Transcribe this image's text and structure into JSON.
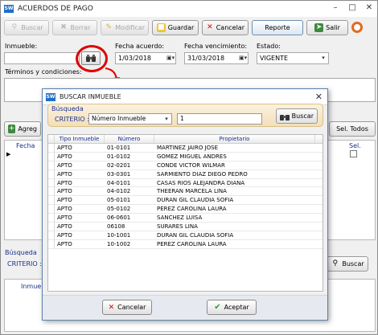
{
  "window": {
    "title": "ACUERDOS DE PAGO"
  },
  "toolbar": {
    "buttons": [
      {
        "label": "Buscar",
        "enabled": false
      },
      {
        "label": "Borrar",
        "enabled": false
      },
      {
        "label": "Modificar",
        "enabled": false
      },
      {
        "label": "Guardar",
        "enabled": true
      },
      {
        "label": "Cancelar",
        "enabled": true
      },
      {
        "label": "Reporte",
        "enabled": true
      },
      {
        "label": "Salir",
        "enabled": true
      }
    ]
  },
  "form": {
    "inmueble_label": "Inmueble:",
    "fecha_acuerdo_label": "Fecha acuerdo:",
    "fecha_acuerdo_value": "1/03/2018",
    "fecha_venc_label": "Fecha vencimiento:",
    "fecha_venc_value": "31/03/2018",
    "estado_label": "Estado:",
    "estado_value": "VIGENTE",
    "terminos_label": "Términos y condiciones:"
  },
  "background": {
    "agregar_label": "Agreg",
    "sel_todos_label": "Sel. Todos",
    "fecha_col": "Fecha",
    "sel_col": "Sel.",
    "busqueda_label": "Búsqueda",
    "criterio_label": "CRITERIO :",
    "buscar_label": "Buscar",
    "inmueble_col": "Inmueb"
  },
  "dialog": {
    "title": "BUSCAR INMUEBLE",
    "busqueda_label": "Búsqueda",
    "criterio_label": "CRITERIO :",
    "criterio_value": "Número Inmueble",
    "search_value": "1",
    "buscar_label": "Buscar",
    "columns": [
      "Tipo Inmueble",
      "Número",
      "Propietario"
    ],
    "rows": [
      {
        "tipo": "APTO",
        "numero": "01-0101",
        "propietario": "MARTINEZ JAIRO JOSE"
      },
      {
        "tipo": "APTO",
        "numero": "01-0102",
        "propietario": "GOMEZ MIGUEL ANDRES"
      },
      {
        "tipo": "APTO",
        "numero": "02-0201",
        "propietario": "CONDE VICTOR WILMAR"
      },
      {
        "tipo": "APTO",
        "numero": "03-0301",
        "propietario": "SARMIENTO DIAZ DIEGO PEDRO"
      },
      {
        "tipo": "APTO",
        "numero": "04-0101",
        "propietario": "CASAS RIOS ALEJANDRA DIANA"
      },
      {
        "tipo": "APTO",
        "numero": "04-0102",
        "propietario": "THEERAN MARCELA LINA"
      },
      {
        "tipo": "APTO",
        "numero": "05-0101",
        "propietario": "DURAN GIL CLAUDIA SOFIA"
      },
      {
        "tipo": "APTO",
        "numero": "05-0102",
        "propietario": "PEREZ CAROLINA LAURA"
      },
      {
        "tipo": "APTO",
        "numero": "06-0601",
        "propietario": "SANCHEZ LUISA"
      },
      {
        "tipo": "APTO",
        "numero": "06108",
        "propietario": "SURARES LINA"
      },
      {
        "tipo": "APTO",
        "numero": "10-1001",
        "propietario": "DURAN GIL CLAUDIA SOFIA"
      },
      {
        "tipo": "APTO",
        "numero": "10-1002",
        "propietario": "PEREZ CAROLINA LAURA"
      }
    ],
    "cancel_label": "Cancelar",
    "accept_label": "Aceptar"
  },
  "colors": {
    "accent": "#1e6fc5",
    "highlight_circle": "#e00000",
    "search_panel": "#f3dfb8"
  }
}
